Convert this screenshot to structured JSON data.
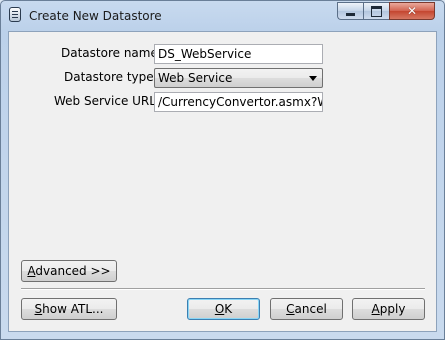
{
  "window": {
    "title": "Create New Datastore",
    "icon": "datastore-icon",
    "controls": {
      "minimize": "minimize-icon",
      "maximize": "maximize-icon",
      "close": "close-icon"
    }
  },
  "form": {
    "name_label": "Datastore name:",
    "name_value": "DS_WebService",
    "type_label": "Datastore type:",
    "type_value": "Web Service",
    "url_label": "Web Service URL:",
    "url_value": "/CurrencyConvertor.asmx?WSDL"
  },
  "buttons": {
    "advanced": {
      "mnemonic": "A",
      "rest": "dvanced >>"
    },
    "show_atl": {
      "mnemonic": "S",
      "rest": "how ATL..."
    },
    "ok": {
      "mnemonic": "O",
      "rest": "K"
    },
    "cancel": {
      "mnemonic": "C",
      "rest": "ancel"
    },
    "apply": {
      "mnemonic": "A",
      "rest": "pply"
    }
  }
}
